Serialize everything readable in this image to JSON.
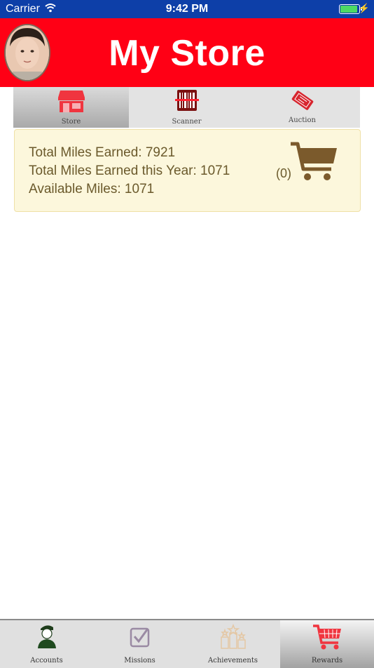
{
  "status_bar": {
    "carrier": "Carrier",
    "time": "9:42 PM",
    "battery_level": 1.0
  },
  "header": {
    "title": "My Store"
  },
  "segments": [
    {
      "label": "Store",
      "icon": "store-icon",
      "active": true
    },
    {
      "label": "Scanner",
      "icon": "barcode-scanner-icon",
      "active": false
    },
    {
      "label": "Auction",
      "icon": "ticket-icon",
      "active": false
    }
  ],
  "miles": {
    "total_earned": "Total Miles Earned: 7921",
    "earned_this_year": "Total Miles Earned this Year: 1071",
    "available": "Available Miles: 1071"
  },
  "cart": {
    "count_label": "(0)",
    "icon": "shopping-cart-icon"
  },
  "tabs": [
    {
      "label": "Accounts",
      "icon": "soldier-icon",
      "active": false
    },
    {
      "label": "Missions",
      "icon": "checkbox-icon",
      "active": false
    },
    {
      "label": "Achievements",
      "icon": "podium-stars-icon",
      "active": false
    },
    {
      "label": "Rewards",
      "icon": "shopping-cart-icon",
      "active": true
    }
  ],
  "colors": {
    "header_red": "#ff0015",
    "status_blue": "#0d3fa8",
    "card_bg": "#fcf7dc",
    "cart_brown": "#7b5a2c"
  }
}
